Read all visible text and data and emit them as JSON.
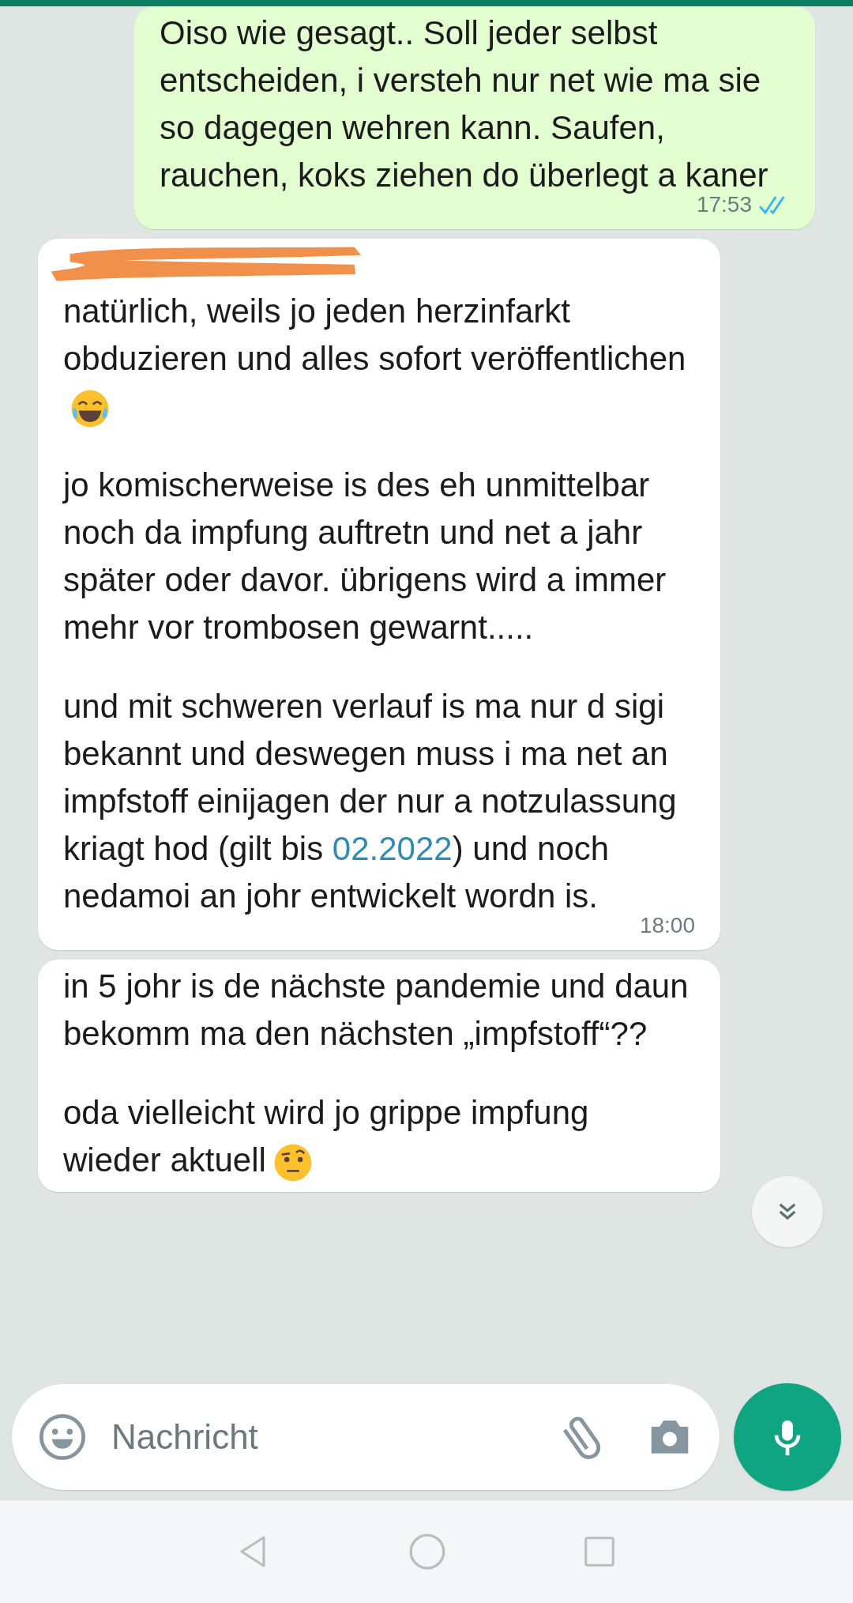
{
  "messages": [
    {
      "kind": "outgoing",
      "paragraphs": [
        [
          {
            "kind": "text",
            "text": "Oiso wie gesagt.. Soll jeder selbst entscheiden, i versteh nur net wie ma sie so dagegen wehren kann. Saufen, rauchen, koks ziehen do überlegt a kaner"
          }
        ]
      ],
      "time": "17:53",
      "read": true
    },
    {
      "kind": "incoming",
      "sender_redacted": true,
      "paragraphs": [
        [
          {
            "kind": "text",
            "text": "natürlich, weils jo jeden herzinfarkt obduzieren und alles sofort veröffentlichen"
          },
          {
            "kind": "laughing_emoji"
          }
        ],
        [
          {
            "kind": "text",
            "text": "jo komischerweise is des eh unmittelbar noch da impfung auftretn und net a jahr später oder davor. übrigens wird a immer mehr vor trombosen gewarnt....."
          }
        ],
        [
          {
            "kind": "text",
            "text": "und mit schweren verlauf is ma nur d sigi bekannt und deswegen muss i ma net an impfstoff einijagen der nur a notzulassung kriagt hod (gilt bis "
          },
          {
            "kind": "link",
            "text": "02.2022"
          },
          {
            "kind": "text",
            "text": ") und noch nedamoi an johr entwickelt wordn is."
          }
        ]
      ],
      "time": "18:00"
    },
    {
      "kind": "incoming",
      "sender_redacted": false,
      "paragraphs": [
        [
          {
            "kind": "text",
            "text": "in 5 johr is de nächste pandemie und daun bekomm ma den nächsten „impfstoff“??"
          }
        ],
        [
          {
            "kind": "text",
            "text": "oda vielleicht wird jo grippe impfung wieder aktuell"
          },
          {
            "kind": "eyebrow_emoji"
          }
        ]
      ]
    }
  ],
  "composer": {
    "placeholder": "Nachricht"
  }
}
